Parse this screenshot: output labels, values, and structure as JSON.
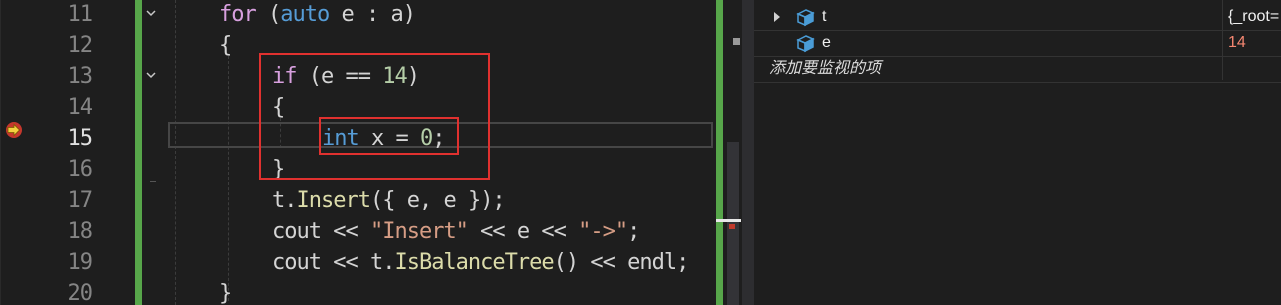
{
  "editor": {
    "line_numbers": [
      "11",
      "12",
      "13",
      "14",
      "15",
      "16",
      "17",
      "18",
      "19",
      "20"
    ],
    "current_line": "15",
    "lines": [
      [
        {
          "t": "for",
          "c": "ctl"
        },
        {
          "t": " (",
          "c": ""
        },
        {
          "t": "auto",
          "c": "kw"
        },
        {
          "t": " e : a)",
          "c": ""
        }
      ],
      [
        {
          "t": "{",
          "c": ""
        }
      ],
      [
        {
          "t": "if",
          "c": "ctl"
        },
        {
          "t": " (e == ",
          "c": ""
        },
        {
          "t": "14",
          "c": "num"
        },
        {
          "t": ")",
          "c": ""
        }
      ],
      [
        {
          "t": "{",
          "c": ""
        }
      ],
      [
        {
          "t": "int",
          "c": "kw"
        },
        {
          "t": " x = ",
          "c": ""
        },
        {
          "t": "0",
          "c": "num"
        },
        {
          "t": ";",
          "c": ""
        }
      ],
      [
        {
          "t": "}",
          "c": ""
        }
      ],
      [
        {
          "t": "t",
          "c": ""
        },
        {
          "t": ".",
          "c": ""
        },
        {
          "t": "Insert",
          "c": "fn"
        },
        {
          "t": "({ e, e });",
          "c": ""
        }
      ],
      [
        {
          "t": "cout << ",
          "c": ""
        },
        {
          "t": "\"Insert\"",
          "c": "str"
        },
        {
          "t": " << e << ",
          "c": ""
        },
        {
          "t": "\"->\"",
          "c": "str"
        },
        {
          "t": ";",
          "c": ""
        }
      ],
      [
        {
          "t": "cout << t.",
          "c": ""
        },
        {
          "t": "IsBalanceTree",
          "c": "fn"
        },
        {
          "t": "() << endl;",
          "c": ""
        }
      ],
      [
        {
          "t": "}",
          "c": ""
        }
      ]
    ],
    "indents": [
      219,
      219,
      272,
      272,
      322,
      272,
      272,
      272,
      272,
      219
    ]
  },
  "watch": {
    "rows": [
      {
        "name": "t",
        "value": "{_root=",
        "expandable": true,
        "changed": false
      },
      {
        "name": "e",
        "value": "14",
        "expandable": false,
        "changed": true
      }
    ],
    "add_placeholder": "添加要监视的项"
  }
}
